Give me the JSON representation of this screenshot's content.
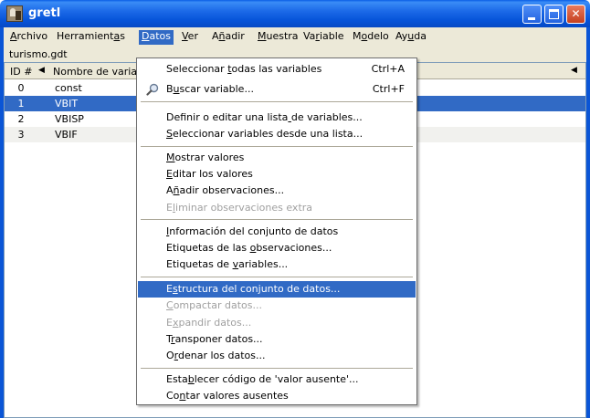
{
  "window": {
    "title": "gretl"
  },
  "menubar": [
    {
      "label": "Archivo",
      "u": 0
    },
    {
      "label": "Herramientas",
      "u": 10
    },
    {
      "label": "Datos",
      "u": 0
    },
    {
      "label": "Ver",
      "u": 0
    },
    {
      "label": "Añadir",
      "u": 1
    },
    {
      "label": "Muestra",
      "u": 0
    },
    {
      "label": "Variable",
      "u": 2
    },
    {
      "label": "Modelo",
      "u": 1
    },
    {
      "label": "Ayuda",
      "u": 2
    }
  ],
  "file": {
    "name": "turismo.gdt"
  },
  "list": {
    "header_id": "ID #",
    "header_name": "Nombre de variab",
    "rows": [
      {
        "id": "0",
        "name": "const"
      },
      {
        "id": "1",
        "name": "VBIT"
      },
      {
        "id": "2",
        "name": "VBISP"
      },
      {
        "id": "3",
        "name": "VBIF"
      }
    ]
  },
  "dropdown": {
    "items": [
      {
        "label": "Seleccionar todas las variables",
        "u": 12,
        "shortcut": "Ctrl+A"
      },
      {
        "label": "Buscar variable...",
        "u": 1,
        "shortcut": "Ctrl+F",
        "icon": "magnifier-icon"
      },
      {
        "label": "Definir o editar una lista de variables...",
        "u": 26
      },
      {
        "label": "Seleccionar variables desde una lista...",
        "u": 0
      },
      {
        "label": "Mostrar valores",
        "u": 0
      },
      {
        "label": "Editar los valores",
        "u": 0
      },
      {
        "label": "Añadir observaciones...",
        "u": 1
      },
      {
        "label": "Eliminar observaciones extra",
        "u": 1,
        "disabled": true
      },
      {
        "label": "Información del conjunto de datos",
        "u": 0
      },
      {
        "label": "Etiquetas de las observaciones...",
        "u": 17
      },
      {
        "label": "Etiquetas de variables...",
        "u": 13
      },
      {
        "label": "Estructura del conjunto de datos...",
        "u": 1,
        "highlight": true
      },
      {
        "label": "Compactar datos...",
        "u": 0,
        "disabled": true
      },
      {
        "label": "Expandir datos...",
        "u": 1,
        "disabled": true
      },
      {
        "label": "Transponer datos...",
        "u": 1
      },
      {
        "label": "Ordenar los datos...",
        "u": 1
      },
      {
        "label": "Establecer código de 'valor ausente'...",
        "u": 4
      },
      {
        "label": "Contar valores ausentes",
        "u": 2
      }
    ]
  },
  "colors": {
    "highlight": "#316ac5",
    "titlebar": "#0653d8",
    "menubar_bg": "#ece9d8"
  }
}
